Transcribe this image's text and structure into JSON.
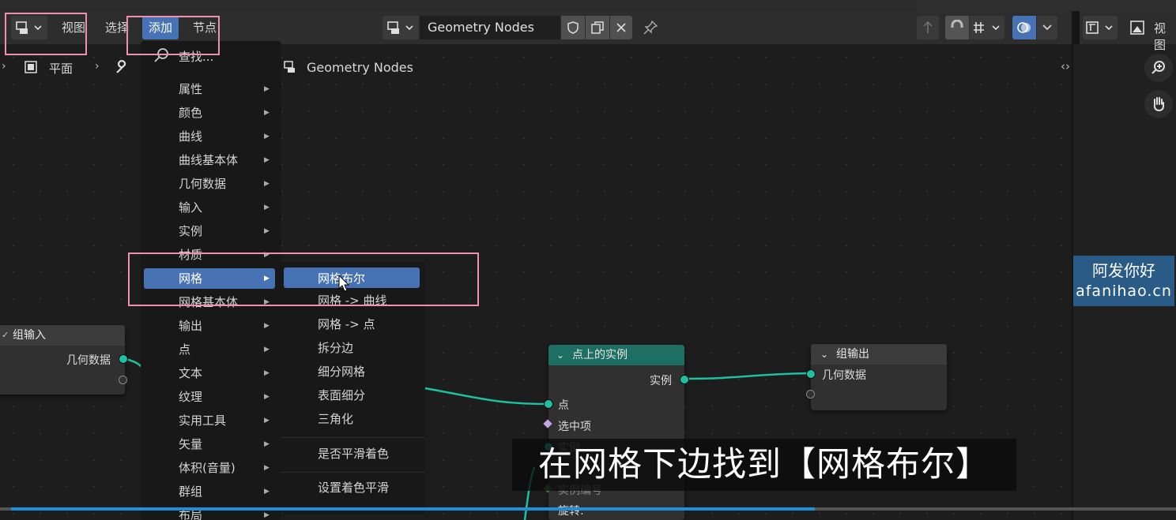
{
  "header": {
    "menus": [
      {
        "label": "视图"
      },
      {
        "label": "选择"
      },
      {
        "label": "添加"
      },
      {
        "label": "节点"
      }
    ],
    "editor_name": "Geometry Nodes",
    "right_view_label": "视图"
  },
  "subheader": {
    "object_label": "平面",
    "breadcrumb": "Geometry Nodes"
  },
  "add_menu": {
    "search_label": "查找...",
    "items": [
      {
        "label": "属性"
      },
      {
        "label": "颜色"
      },
      {
        "label": "曲线"
      },
      {
        "label": "曲线基本体"
      },
      {
        "label": "几何数据"
      },
      {
        "label": "输入"
      },
      {
        "label": "实例"
      },
      {
        "label": "材质"
      },
      {
        "label": "网格"
      },
      {
        "label": "网格基本体"
      },
      {
        "label": "输出"
      },
      {
        "label": "点"
      },
      {
        "label": "文本"
      },
      {
        "label": "纹理"
      },
      {
        "label": "实用工具"
      },
      {
        "label": "矢量"
      },
      {
        "label": "体积(音量)"
      },
      {
        "label": "群组"
      },
      {
        "label": "布局"
      }
    ],
    "active_item": "网格"
  },
  "mesh_submenu": {
    "items": [
      {
        "label": "网格布尔"
      },
      {
        "label": "网格 -> 曲线"
      },
      {
        "label": "网格 -> 点"
      },
      {
        "label": "拆分边"
      },
      {
        "label": "细分网格"
      },
      {
        "label": "表面细分"
      },
      {
        "label": "三角化"
      },
      {
        "label": "是否平滑着色"
      },
      {
        "label": "设置着色平滑"
      }
    ],
    "active_item": "网格布尔"
  },
  "nodes": {
    "group_input": {
      "title": "组输入",
      "output": "几何数据"
    },
    "instance_on_points": {
      "title": "点上的实例",
      "output": "实例",
      "inputs": [
        "点",
        "选中项",
        "实例",
        "实例编号",
        "旋转:"
      ]
    },
    "group_output": {
      "title": "组输出",
      "input": "几何数据"
    }
  },
  "watermark": {
    "line1": "阿发你好",
    "line2": "afanihao.cn"
  },
  "subtitle": "在网格下边找到【网格布尔】",
  "video_progress": 0.69,
  "colors": {
    "accent": "#4772b3",
    "geometry_socket": "#1fbfa2",
    "instance_header": "#1d6e63",
    "highlight_box": "#ef8fb2"
  }
}
